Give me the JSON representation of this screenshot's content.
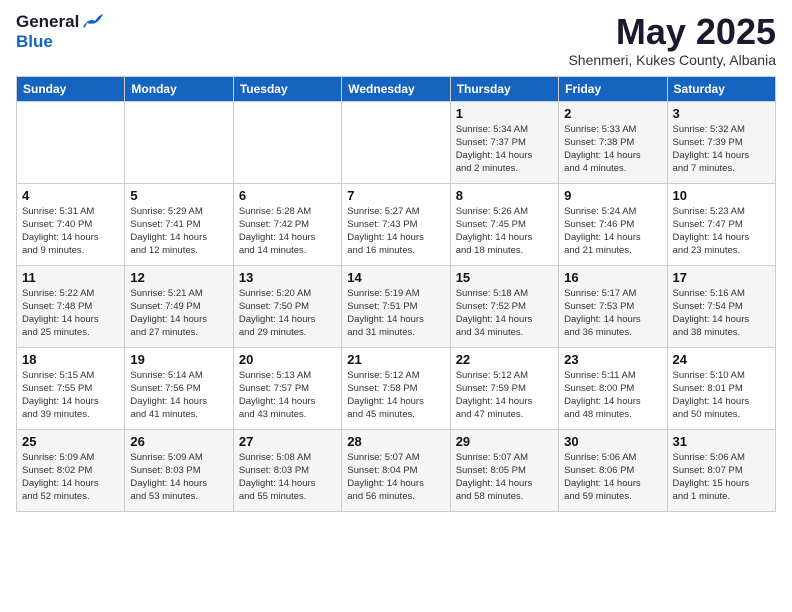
{
  "header": {
    "logo_general": "General",
    "logo_blue": "Blue",
    "month_title": "May 2025",
    "location": "Shenmeri, Kukes County, Albania"
  },
  "weekdays": [
    "Sunday",
    "Monday",
    "Tuesday",
    "Wednesday",
    "Thursday",
    "Friday",
    "Saturday"
  ],
  "weeks": [
    [
      {
        "day": "",
        "info": ""
      },
      {
        "day": "",
        "info": ""
      },
      {
        "day": "",
        "info": ""
      },
      {
        "day": "",
        "info": ""
      },
      {
        "day": "1",
        "info": "Sunrise: 5:34 AM\nSunset: 7:37 PM\nDaylight: 14 hours\nand 2 minutes."
      },
      {
        "day": "2",
        "info": "Sunrise: 5:33 AM\nSunset: 7:38 PM\nDaylight: 14 hours\nand 4 minutes."
      },
      {
        "day": "3",
        "info": "Sunrise: 5:32 AM\nSunset: 7:39 PM\nDaylight: 14 hours\nand 7 minutes."
      }
    ],
    [
      {
        "day": "4",
        "info": "Sunrise: 5:31 AM\nSunset: 7:40 PM\nDaylight: 14 hours\nand 9 minutes."
      },
      {
        "day": "5",
        "info": "Sunrise: 5:29 AM\nSunset: 7:41 PM\nDaylight: 14 hours\nand 12 minutes."
      },
      {
        "day": "6",
        "info": "Sunrise: 5:28 AM\nSunset: 7:42 PM\nDaylight: 14 hours\nand 14 minutes."
      },
      {
        "day": "7",
        "info": "Sunrise: 5:27 AM\nSunset: 7:43 PM\nDaylight: 14 hours\nand 16 minutes."
      },
      {
        "day": "8",
        "info": "Sunrise: 5:26 AM\nSunset: 7:45 PM\nDaylight: 14 hours\nand 18 minutes."
      },
      {
        "day": "9",
        "info": "Sunrise: 5:24 AM\nSunset: 7:46 PM\nDaylight: 14 hours\nand 21 minutes."
      },
      {
        "day": "10",
        "info": "Sunrise: 5:23 AM\nSunset: 7:47 PM\nDaylight: 14 hours\nand 23 minutes."
      }
    ],
    [
      {
        "day": "11",
        "info": "Sunrise: 5:22 AM\nSunset: 7:48 PM\nDaylight: 14 hours\nand 25 minutes."
      },
      {
        "day": "12",
        "info": "Sunrise: 5:21 AM\nSunset: 7:49 PM\nDaylight: 14 hours\nand 27 minutes."
      },
      {
        "day": "13",
        "info": "Sunrise: 5:20 AM\nSunset: 7:50 PM\nDaylight: 14 hours\nand 29 minutes."
      },
      {
        "day": "14",
        "info": "Sunrise: 5:19 AM\nSunset: 7:51 PM\nDaylight: 14 hours\nand 31 minutes."
      },
      {
        "day": "15",
        "info": "Sunrise: 5:18 AM\nSunset: 7:52 PM\nDaylight: 14 hours\nand 34 minutes."
      },
      {
        "day": "16",
        "info": "Sunrise: 5:17 AM\nSunset: 7:53 PM\nDaylight: 14 hours\nand 36 minutes."
      },
      {
        "day": "17",
        "info": "Sunrise: 5:16 AM\nSunset: 7:54 PM\nDaylight: 14 hours\nand 38 minutes."
      }
    ],
    [
      {
        "day": "18",
        "info": "Sunrise: 5:15 AM\nSunset: 7:55 PM\nDaylight: 14 hours\nand 39 minutes."
      },
      {
        "day": "19",
        "info": "Sunrise: 5:14 AM\nSunset: 7:56 PM\nDaylight: 14 hours\nand 41 minutes."
      },
      {
        "day": "20",
        "info": "Sunrise: 5:13 AM\nSunset: 7:57 PM\nDaylight: 14 hours\nand 43 minutes."
      },
      {
        "day": "21",
        "info": "Sunrise: 5:12 AM\nSunset: 7:58 PM\nDaylight: 14 hours\nand 45 minutes."
      },
      {
        "day": "22",
        "info": "Sunrise: 5:12 AM\nSunset: 7:59 PM\nDaylight: 14 hours\nand 47 minutes."
      },
      {
        "day": "23",
        "info": "Sunrise: 5:11 AM\nSunset: 8:00 PM\nDaylight: 14 hours\nand 48 minutes."
      },
      {
        "day": "24",
        "info": "Sunrise: 5:10 AM\nSunset: 8:01 PM\nDaylight: 14 hours\nand 50 minutes."
      }
    ],
    [
      {
        "day": "25",
        "info": "Sunrise: 5:09 AM\nSunset: 8:02 PM\nDaylight: 14 hours\nand 52 minutes."
      },
      {
        "day": "26",
        "info": "Sunrise: 5:09 AM\nSunset: 8:03 PM\nDaylight: 14 hours\nand 53 minutes."
      },
      {
        "day": "27",
        "info": "Sunrise: 5:08 AM\nSunset: 8:03 PM\nDaylight: 14 hours\nand 55 minutes."
      },
      {
        "day": "28",
        "info": "Sunrise: 5:07 AM\nSunset: 8:04 PM\nDaylight: 14 hours\nand 56 minutes."
      },
      {
        "day": "29",
        "info": "Sunrise: 5:07 AM\nSunset: 8:05 PM\nDaylight: 14 hours\nand 58 minutes."
      },
      {
        "day": "30",
        "info": "Sunrise: 5:06 AM\nSunset: 8:06 PM\nDaylight: 14 hours\nand 59 minutes."
      },
      {
        "day": "31",
        "info": "Sunrise: 5:06 AM\nSunset: 8:07 PM\nDaylight: 15 hours\nand 1 minute."
      }
    ]
  ]
}
